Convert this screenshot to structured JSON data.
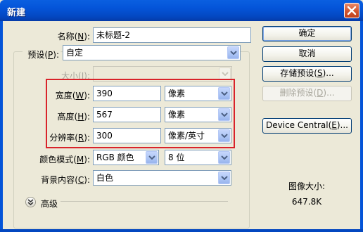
{
  "window": {
    "title": "新建"
  },
  "fields": {
    "name": {
      "label": "名称",
      "key": "N",
      "value": "未标题-2"
    },
    "preset": {
      "label": "预设",
      "key": "P",
      "value": "自定"
    },
    "size": {
      "label": "大小",
      "key": "I",
      "value": ""
    },
    "width": {
      "label": "宽度",
      "key": "W",
      "value": "390",
      "unit": "像素"
    },
    "height": {
      "label": "高度",
      "key": "H",
      "value": "567",
      "unit": "像素"
    },
    "resolution": {
      "label": "分辨率",
      "key": "R",
      "value": "300",
      "unit": "像素/英寸"
    },
    "color_mode": {
      "label": "颜色模式",
      "key": "M",
      "value": "RGB 颜色",
      "depth": "8 位"
    },
    "background": {
      "label": "背景内容",
      "key": "C",
      "value": "白色"
    }
  },
  "advanced_label": "高级",
  "buttons": {
    "ok": "确定",
    "cancel": "取消",
    "save_preset": {
      "text": "存储预设",
      "key": "S"
    },
    "delete_preset": {
      "text": "删除预设",
      "key": "D"
    },
    "device_central": {
      "text": "Device Central",
      "key": "E"
    }
  },
  "image_size": {
    "label": "图像大小:",
    "value": "647.8K"
  },
  "colors": {
    "titlebar": "#0454d8",
    "highlight_box": "#d9232a",
    "dialog_bg": "#ece9d8"
  }
}
